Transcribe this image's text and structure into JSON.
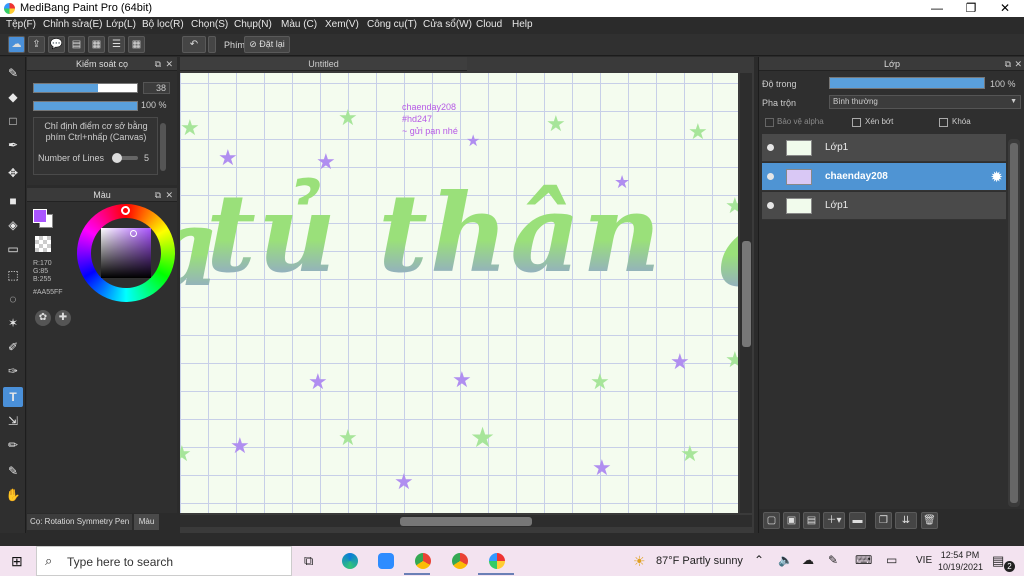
{
  "window": {
    "title": "MediBang Paint Pro (64bit)",
    "minimize": "—",
    "maximize": "❐",
    "close": "✕"
  },
  "menu": [
    "Tệp(F)",
    "Chỉnh sửa(E)",
    "Lớp(L)",
    "Bộ lọc(R)",
    "Chọn(S)",
    "Chụp(N)",
    "Màu (C)",
    "Xem(V)",
    "Công cụ(T)",
    "Cửa sổ(W)",
    "Cloud",
    "Help"
  ],
  "toolbar": {
    "undo_icon": "undo-icon",
    "shortcut_label": "Phím",
    "reset_label": "Đặt lại"
  },
  "brush_panel": {
    "title": "Kiểm soát cọ",
    "size_value": "38",
    "size_fraction": 0.62,
    "opacity_value": "100 %",
    "opacity_fraction": 1.0,
    "hint": "Chỉ định điểm cơ sở bằng phím Ctrl+nhấp (Canvas)",
    "lines_label": "Number of Lines",
    "lines_value": "5"
  },
  "color_panel": {
    "title": "Màu",
    "rgb_r": "R:170",
    "rgb_g": "G:85",
    "rgb_b": "B:255",
    "hex": "#AA55FF",
    "foreground": "#AA55FF"
  },
  "bottom_tabs": {
    "brush_tab": "Cọ: Rotation Symmetry Pen",
    "color_tab": "Màu"
  },
  "canvas": {
    "tab_title": "Untitled",
    "note_line1": "chaenday208",
    "note_line2": "#hd247",
    "note_line3": "~ gửi pạn nhé",
    "big_text": "tủ thân",
    "big_text_left": "a",
    "big_text_right": "a"
  },
  "layers_panel": {
    "title": "Lớp",
    "opacity_label": "Độ trong",
    "opacity_value": "100 %",
    "blend_label": "Pha trộn",
    "blend_value": "Bình thường",
    "protect_alpha": "Bảo vệ alpha",
    "clipping": "Xén bớt",
    "lock": "Khóa",
    "layers": [
      {
        "name": "Lớp1",
        "selected": false
      },
      {
        "name": "chaenday208",
        "selected": true
      },
      {
        "name": "Lớp1",
        "selected": false
      }
    ]
  },
  "taskbar": {
    "search_placeholder": "Type here to search",
    "weather": "87°F  Partly sunny",
    "language": "VIE",
    "time": "12:54 PM",
    "date": "10/19/2021",
    "notification_count": "2"
  }
}
